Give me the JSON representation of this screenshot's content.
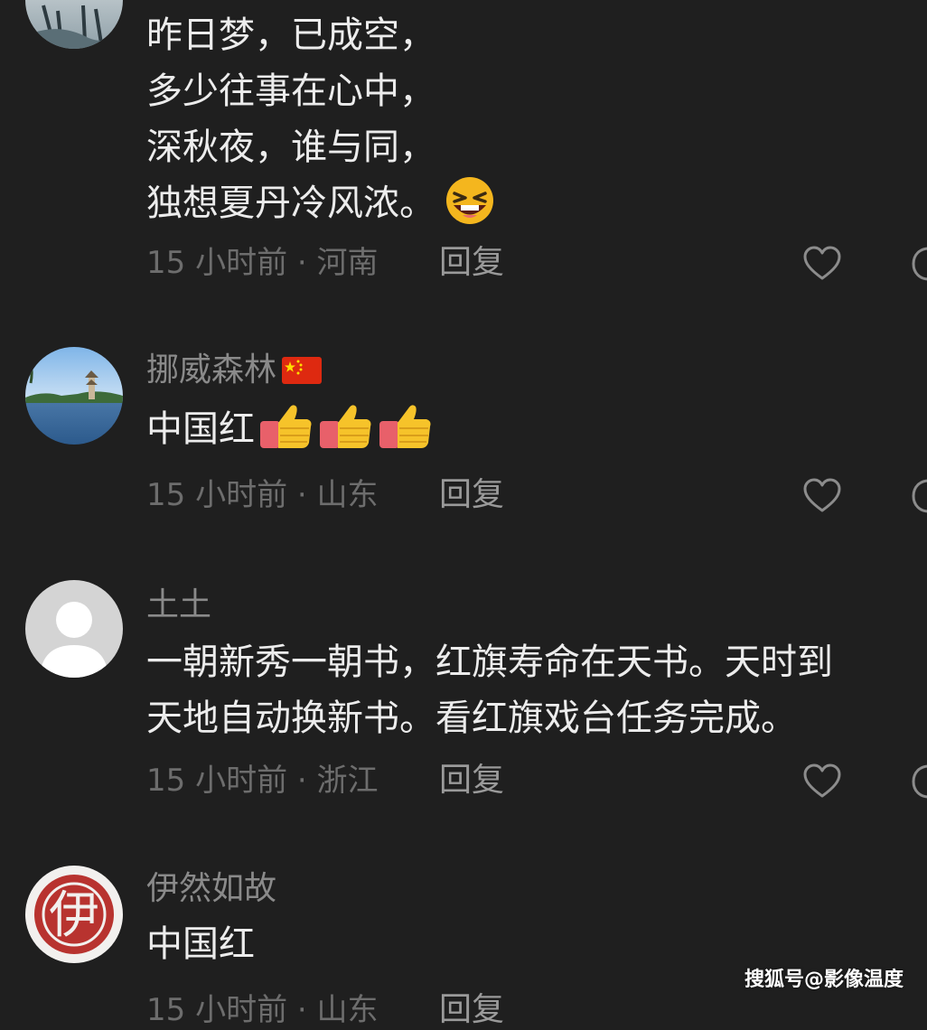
{
  "comments": [
    {
      "username": "",
      "content_lines": [
        "昨日梦，已成空，",
        "多少往事在心中，",
        "深秋夜，谁与同，",
        "独想夏丹冷风浓。"
      ],
      "emojis": [
        "laughing-face"
      ],
      "meta": "15 小时前 · 河南",
      "reply_label": "回复",
      "avatar": "calligraphy-landscape-avatar"
    },
    {
      "username": "挪威森林",
      "username_badge": "china-flag",
      "content_lines": [
        "中国红"
      ],
      "emojis": [
        "thumbs-up",
        "thumbs-up",
        "thumbs-up"
      ],
      "meta": "15 小时前 · 山东",
      "reply_label": "回复",
      "avatar": "lake-pagoda-avatar"
    },
    {
      "username": "土土",
      "content_lines": [
        "一朝新秀一朝书，红旗寿命在天书。天时到",
        "天地自动换新书。看红旗戏台任务完成。"
      ],
      "meta": "15 小时前 · 浙江",
      "reply_label": "回复",
      "avatar": "default-user-avatar"
    },
    {
      "username": "伊然如故",
      "content_lines": [
        "中国红"
      ],
      "meta": "15 小时前 · 山东",
      "reply_label": "回复",
      "avatar": "red-seal-avatar",
      "avatar_text": "伊"
    }
  ],
  "watermark": "搜狐号@影像温度",
  "colors": {
    "background": "#1f1f1f",
    "text_primary": "#ececec",
    "text_secondary": "#6d6d6d",
    "username": "#8a8a8a",
    "seal_red": "#b8332f"
  }
}
